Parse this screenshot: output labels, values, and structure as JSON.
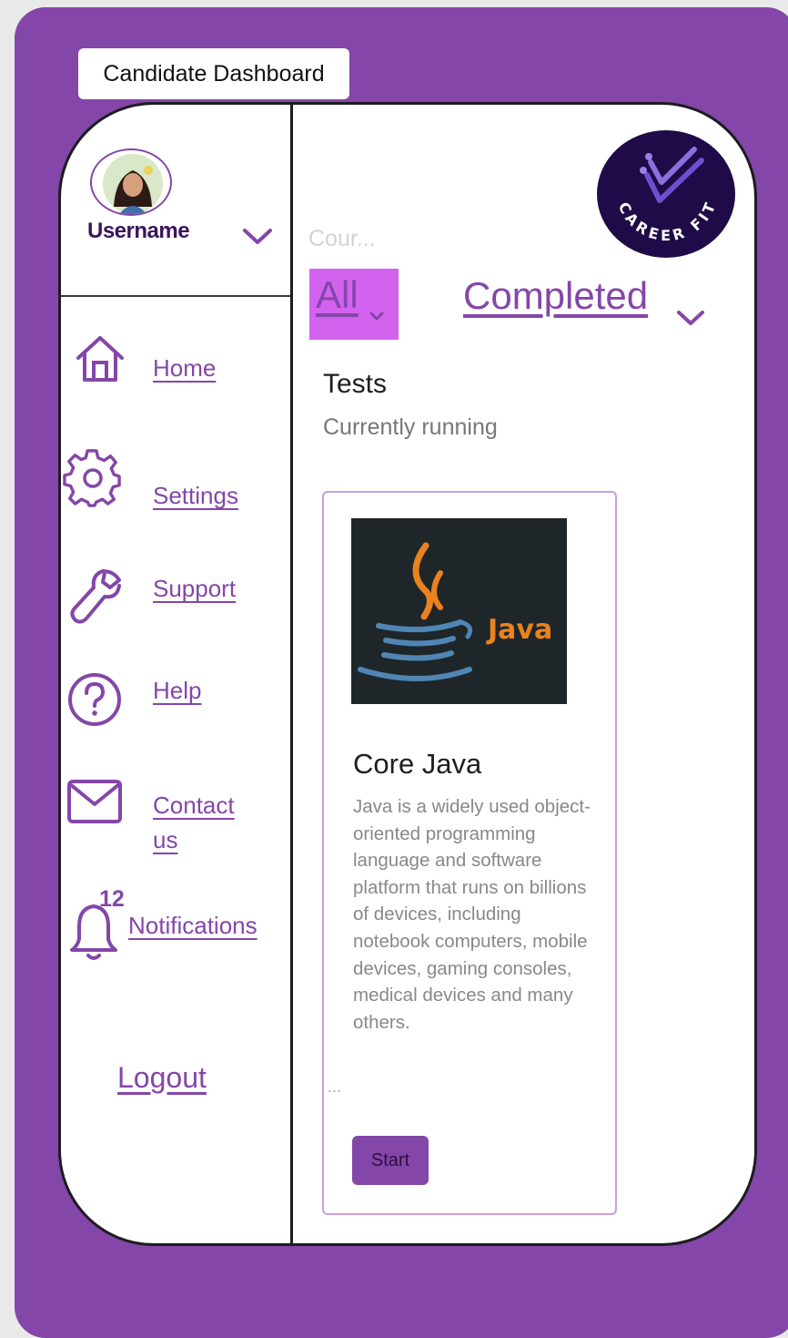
{
  "window": {
    "title": "Candidate Dashboard"
  },
  "sidebar": {
    "username": "Username",
    "items": [
      {
        "label": "Home",
        "icon": "home-icon"
      },
      {
        "label": "Settings",
        "icon": "gear-icon"
      },
      {
        "label": "Support",
        "icon": "wrench-icon"
      },
      {
        "label": "Help",
        "icon": "help-icon"
      },
      {
        "label": "Contact us",
        "icon": "mail-icon"
      },
      {
        "label": "Notifications",
        "icon": "bell-icon",
        "badge": "12"
      }
    ],
    "logout": "Logout"
  },
  "main": {
    "logo_text": "CAREER FIT",
    "search": {
      "placeholder": "Cour..."
    },
    "filters": {
      "all": "All",
      "completed": "Completed"
    },
    "section_title": "Tests",
    "section_subtitle": "Currently running",
    "course": {
      "image_text": "Java",
      "title": "Core Java",
      "description": "Java is a widely used object-oriented programming language and software platform that runs on billions of devices, including notebook computers, mobile devices, gaming consoles, medical devices and many others.",
      "button": "Start"
    },
    "more": "..."
  },
  "colors": {
    "brand": "#8446a8",
    "highlight": "#d363ef",
    "dark": "#1c1c22"
  }
}
